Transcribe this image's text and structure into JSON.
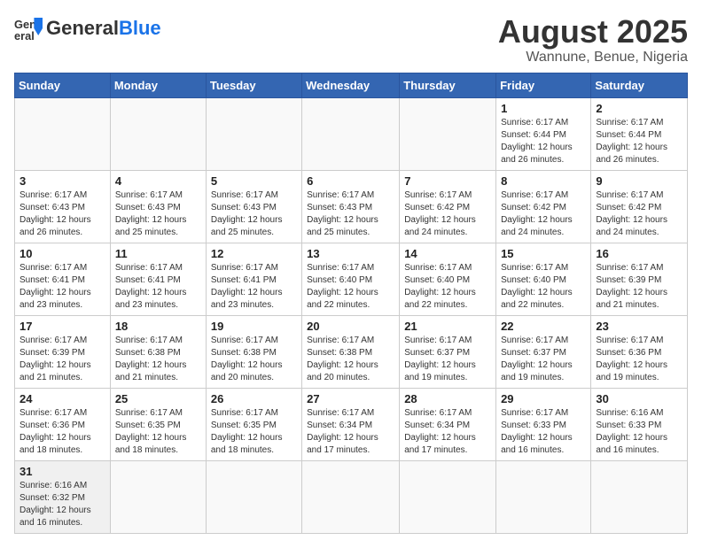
{
  "logo": {
    "text_general": "General",
    "text_blue": "Blue"
  },
  "title": "August 2025",
  "subtitle": "Wannune, Benue, Nigeria",
  "weekdays": [
    "Sunday",
    "Monday",
    "Tuesday",
    "Wednesday",
    "Thursday",
    "Friday",
    "Saturday"
  ],
  "weeks": [
    [
      {
        "day": "",
        "info": ""
      },
      {
        "day": "",
        "info": ""
      },
      {
        "day": "",
        "info": ""
      },
      {
        "day": "",
        "info": ""
      },
      {
        "day": "",
        "info": ""
      },
      {
        "day": "1",
        "info": "Sunrise: 6:17 AM\nSunset: 6:44 PM\nDaylight: 12 hours\nand 26 minutes."
      },
      {
        "day": "2",
        "info": "Sunrise: 6:17 AM\nSunset: 6:44 PM\nDaylight: 12 hours\nand 26 minutes."
      }
    ],
    [
      {
        "day": "3",
        "info": "Sunrise: 6:17 AM\nSunset: 6:43 PM\nDaylight: 12 hours\nand 26 minutes."
      },
      {
        "day": "4",
        "info": "Sunrise: 6:17 AM\nSunset: 6:43 PM\nDaylight: 12 hours\nand 25 minutes."
      },
      {
        "day": "5",
        "info": "Sunrise: 6:17 AM\nSunset: 6:43 PM\nDaylight: 12 hours\nand 25 minutes."
      },
      {
        "day": "6",
        "info": "Sunrise: 6:17 AM\nSunset: 6:43 PM\nDaylight: 12 hours\nand 25 minutes."
      },
      {
        "day": "7",
        "info": "Sunrise: 6:17 AM\nSunset: 6:42 PM\nDaylight: 12 hours\nand 24 minutes."
      },
      {
        "day": "8",
        "info": "Sunrise: 6:17 AM\nSunset: 6:42 PM\nDaylight: 12 hours\nand 24 minutes."
      },
      {
        "day": "9",
        "info": "Sunrise: 6:17 AM\nSunset: 6:42 PM\nDaylight: 12 hours\nand 24 minutes."
      }
    ],
    [
      {
        "day": "10",
        "info": "Sunrise: 6:17 AM\nSunset: 6:41 PM\nDaylight: 12 hours\nand 23 minutes."
      },
      {
        "day": "11",
        "info": "Sunrise: 6:17 AM\nSunset: 6:41 PM\nDaylight: 12 hours\nand 23 minutes."
      },
      {
        "day": "12",
        "info": "Sunrise: 6:17 AM\nSunset: 6:41 PM\nDaylight: 12 hours\nand 23 minutes."
      },
      {
        "day": "13",
        "info": "Sunrise: 6:17 AM\nSunset: 6:40 PM\nDaylight: 12 hours\nand 22 minutes."
      },
      {
        "day": "14",
        "info": "Sunrise: 6:17 AM\nSunset: 6:40 PM\nDaylight: 12 hours\nand 22 minutes."
      },
      {
        "day": "15",
        "info": "Sunrise: 6:17 AM\nSunset: 6:40 PM\nDaylight: 12 hours\nand 22 minutes."
      },
      {
        "day": "16",
        "info": "Sunrise: 6:17 AM\nSunset: 6:39 PM\nDaylight: 12 hours\nand 21 minutes."
      }
    ],
    [
      {
        "day": "17",
        "info": "Sunrise: 6:17 AM\nSunset: 6:39 PM\nDaylight: 12 hours\nand 21 minutes."
      },
      {
        "day": "18",
        "info": "Sunrise: 6:17 AM\nSunset: 6:38 PM\nDaylight: 12 hours\nand 21 minutes."
      },
      {
        "day": "19",
        "info": "Sunrise: 6:17 AM\nSunset: 6:38 PM\nDaylight: 12 hours\nand 20 minutes."
      },
      {
        "day": "20",
        "info": "Sunrise: 6:17 AM\nSunset: 6:38 PM\nDaylight: 12 hours\nand 20 minutes."
      },
      {
        "day": "21",
        "info": "Sunrise: 6:17 AM\nSunset: 6:37 PM\nDaylight: 12 hours\nand 19 minutes."
      },
      {
        "day": "22",
        "info": "Sunrise: 6:17 AM\nSunset: 6:37 PM\nDaylight: 12 hours\nand 19 minutes."
      },
      {
        "day": "23",
        "info": "Sunrise: 6:17 AM\nSunset: 6:36 PM\nDaylight: 12 hours\nand 19 minutes."
      }
    ],
    [
      {
        "day": "24",
        "info": "Sunrise: 6:17 AM\nSunset: 6:36 PM\nDaylight: 12 hours\nand 18 minutes."
      },
      {
        "day": "25",
        "info": "Sunrise: 6:17 AM\nSunset: 6:35 PM\nDaylight: 12 hours\nand 18 minutes."
      },
      {
        "day": "26",
        "info": "Sunrise: 6:17 AM\nSunset: 6:35 PM\nDaylight: 12 hours\nand 18 minutes."
      },
      {
        "day": "27",
        "info": "Sunrise: 6:17 AM\nSunset: 6:34 PM\nDaylight: 12 hours\nand 17 minutes."
      },
      {
        "day": "28",
        "info": "Sunrise: 6:17 AM\nSunset: 6:34 PM\nDaylight: 12 hours\nand 17 minutes."
      },
      {
        "day": "29",
        "info": "Sunrise: 6:17 AM\nSunset: 6:33 PM\nDaylight: 12 hours\nand 16 minutes."
      },
      {
        "day": "30",
        "info": "Sunrise: 6:16 AM\nSunset: 6:33 PM\nDaylight: 12 hours\nand 16 minutes."
      }
    ],
    [
      {
        "day": "31",
        "info": "Sunrise: 6:16 AM\nSunset: 6:32 PM\nDaylight: 12 hours\nand 16 minutes."
      },
      {
        "day": "",
        "info": ""
      },
      {
        "day": "",
        "info": ""
      },
      {
        "day": "",
        "info": ""
      },
      {
        "day": "",
        "info": ""
      },
      {
        "day": "",
        "info": ""
      },
      {
        "day": "",
        "info": ""
      }
    ]
  ]
}
